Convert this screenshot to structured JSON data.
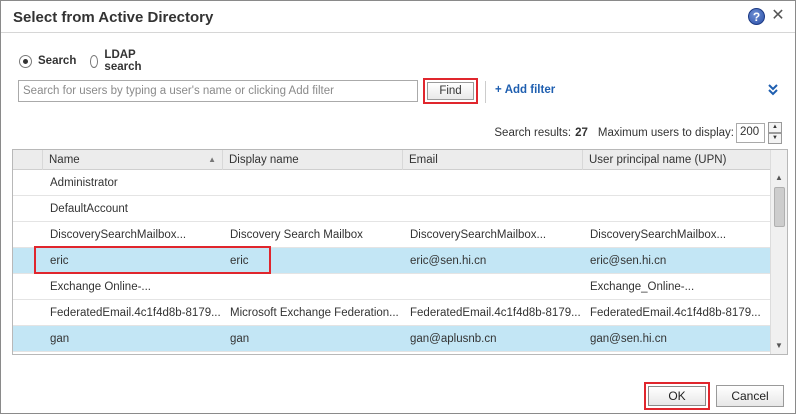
{
  "window": {
    "title": "Select from Active Directory",
    "help_icon": "question-circle-icon",
    "close_icon": "close-icon",
    "help_glyph": "?",
    "close_glyph": "✕"
  },
  "search_mode": {
    "options": [
      {
        "label": "Search",
        "checked": true
      },
      {
        "label": "LDAP search",
        "checked": false
      }
    ]
  },
  "search": {
    "placeholder": "Search for users by typing a user's name or clicking Add filter",
    "value": "",
    "find_label": "Find",
    "add_filter_label": "Add filter",
    "add_filter_glyph": "+",
    "expand_glyph": "⌄⌄"
  },
  "results": {
    "label": "Search results:",
    "count": "27",
    "max_label": "Maximum users to display:",
    "max_value": "200"
  },
  "table": {
    "columns": [
      "Name",
      "Display name",
      "Email",
      "User principal name (UPN)"
    ],
    "sort_column": "Name",
    "sort_direction": "ascending",
    "rows": [
      {
        "name": "Administrator",
        "display": "",
        "email": "",
        "upn": "",
        "selected": false
      },
      {
        "name": "DefaultAccount",
        "display": "",
        "email": "",
        "upn": "",
        "selected": false
      },
      {
        "name": "DiscoverySearchMailbox...",
        "display": "Discovery Search Mailbox",
        "email": "DiscoverySearchMailbox...",
        "upn": "DiscoverySearchMailbox...",
        "selected": false
      },
      {
        "name": "eric",
        "display": "eric",
        "email": "eric@sen.hi.cn",
        "upn": "eric@sen.hi.cn",
        "selected": true
      },
      {
        "name": "Exchange Online-...",
        "display": "",
        "email": "",
        "upn": "Exchange_Online-...",
        "selected": false
      },
      {
        "name": "FederatedEmail.4c1f4d8b-8179...",
        "display": "Microsoft Exchange Federation...",
        "email": "FederatedEmail.4c1f4d8b-8179...",
        "upn": "FederatedEmail.4c1f4d8b-8179...",
        "selected": false
      },
      {
        "name": "gan",
        "display": "gan",
        "email": "gan@aplusnb.cn",
        "upn": "gan@sen.hi.cn",
        "selected": true
      }
    ]
  },
  "footer": {
    "ok_label": "OK",
    "cancel_label": "Cancel"
  },
  "colors": {
    "highlight_border": "#e0262d",
    "selected_row": "#c3e6f5",
    "link": "#1f5fb0"
  }
}
